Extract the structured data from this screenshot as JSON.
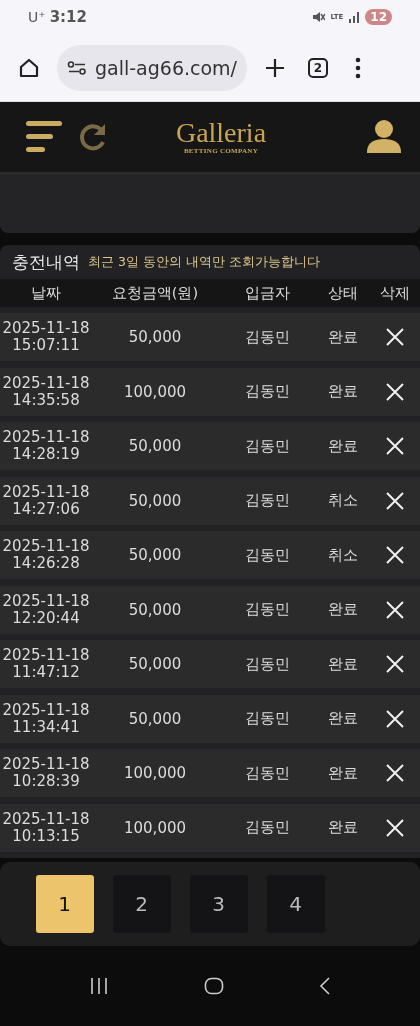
{
  "status_bar": {
    "carrier": "U⁺",
    "time": "3:12",
    "network": "LTE",
    "battery": "12"
  },
  "browser": {
    "url": "gall-ag66.com/",
    "tab_count": "2"
  },
  "header": {
    "logo": "Galleria",
    "logo_sub": "BETTING COMPANY"
  },
  "section": {
    "title": "충전내역",
    "note": "최근 3일 동안의 내역만 조회가능합니다"
  },
  "table": {
    "columns": [
      "날짜",
      "요청금액(원)",
      "입금자",
      "상태",
      "삭제"
    ],
    "rows": [
      {
        "date": "2025-11-18",
        "time": "15:07:11",
        "amount": "50,000",
        "depositor": "김동민",
        "status": "완료"
      },
      {
        "date": "2025-11-18",
        "time": "14:35:58",
        "amount": "100,000",
        "depositor": "김동민",
        "status": "완료"
      },
      {
        "date": "2025-11-18",
        "time": "14:28:19",
        "amount": "50,000",
        "depositor": "김동민",
        "status": "완료"
      },
      {
        "date": "2025-11-18",
        "time": "14:27:06",
        "amount": "50,000",
        "depositor": "김동민",
        "status": "취소"
      },
      {
        "date": "2025-11-18",
        "time": "14:26:28",
        "amount": "50,000",
        "depositor": "김동민",
        "status": "취소"
      },
      {
        "date": "2025-11-18",
        "time": "12:20:44",
        "amount": "50,000",
        "depositor": "김동민",
        "status": "완료"
      },
      {
        "date": "2025-11-18",
        "time": "11:47:12",
        "amount": "50,000",
        "depositor": "김동민",
        "status": "완료"
      },
      {
        "date": "2025-11-18",
        "time": "11:34:41",
        "amount": "50,000",
        "depositor": "김동민",
        "status": "완료"
      },
      {
        "date": "2025-11-18",
        "time": "10:28:39",
        "amount": "100,000",
        "depositor": "김동민",
        "status": "완료"
      },
      {
        "date": "2025-11-18",
        "time": "10:13:15",
        "amount": "100,000",
        "depositor": "김동민",
        "status": "완료"
      }
    ]
  },
  "pagination": [
    {
      "label": "1",
      "selected": true
    },
    {
      "label": "2",
      "selected": false
    },
    {
      "label": "3",
      "selected": false
    },
    {
      "label": "4",
      "selected": false
    }
  ]
}
